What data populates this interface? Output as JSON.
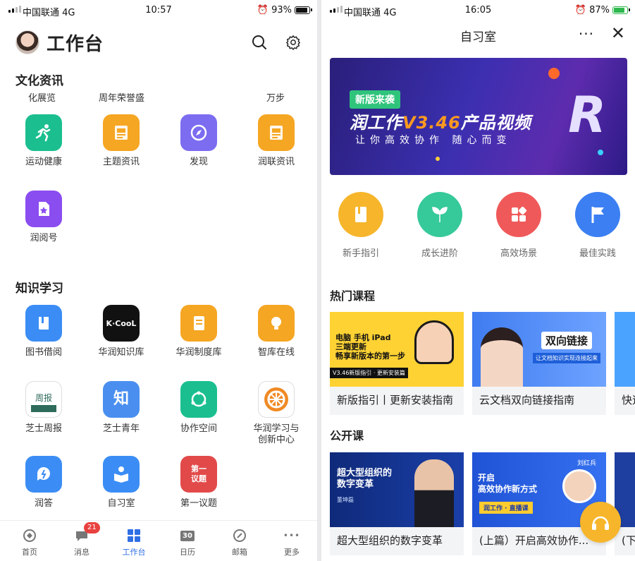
{
  "left_screen": {
    "status": {
      "carrier": "中国联通 4G",
      "time": "10:57",
      "battery": "93%",
      "battery_level": 0.93
    },
    "header": {
      "title": "工作台"
    },
    "culture": {
      "title": "文化资讯",
      "sublabels": [
        "化展览",
        "周年荣誉盛",
        "万步"
      ],
      "apps": [
        {
          "label": "运动健康",
          "icon": "running-icon",
          "color": "#1bbf8f"
        },
        {
          "label": "主题资讯",
          "icon": "news-icon",
          "color": "#f5a623"
        },
        {
          "label": "发现",
          "icon": "compass-icon",
          "color": "#7b6cf0"
        },
        {
          "label": "润联资讯",
          "icon": "news-icon",
          "color": "#f5a623"
        },
        {
          "label": "润阅号",
          "icon": "star-doc-icon",
          "color": "#8a4df0"
        }
      ]
    },
    "knowledge": {
      "title": "知识学习",
      "apps": [
        {
          "label": "图书借阅",
          "icon": "book-icon",
          "color": "#3b8df5"
        },
        {
          "label": "华润知识库",
          "icon": "kcool-logo",
          "color": "#111111",
          "logo_text": "K·CooL"
        },
        {
          "label": "华润制度库",
          "icon": "manual-icon",
          "color": "#f5a623"
        },
        {
          "label": "智库在线",
          "icon": "bulb-icon",
          "color": "#f5a623"
        },
        {
          "label": "芝士周报",
          "icon": "weekly-icon",
          "color": "#2e6b5b"
        },
        {
          "label": "芝士青年",
          "icon": "zhi-icon",
          "color": "#4a8ff0",
          "glyph": "知"
        },
        {
          "label": "协作空间",
          "icon": "collab-icon",
          "color": "#1bbf8f"
        },
        {
          "label": "华润学习与\n创新中心",
          "icon": "emblem-icon",
          "color": "#f08a24"
        },
        {
          "label": "润答",
          "icon": "qa-icon",
          "color": "#3b8df5"
        },
        {
          "label": "自习室",
          "icon": "reader-icon",
          "color": "#3b8df5"
        },
        {
          "label": "第一议题",
          "icon": "topic-icon",
          "color": "#e24a4a",
          "glyph": "第一\n议题"
        }
      ]
    },
    "tabbar": [
      {
        "label": "首页",
        "icon": "home-icon"
      },
      {
        "label": "消息",
        "icon": "message-icon",
        "badge": "21"
      },
      {
        "label": "工作台",
        "icon": "grid-icon",
        "active": true
      },
      {
        "label": "日历",
        "icon": "calendar-icon",
        "glyph": "30"
      },
      {
        "label": "邮箱",
        "icon": "mail-icon"
      },
      {
        "label": "更多",
        "icon": "more-icon",
        "glyph": "•••"
      }
    ]
  },
  "right_screen": {
    "status": {
      "carrier": "中国联通 4G",
      "time": "16:05",
      "battery": "87%",
      "battery_level": 0.87
    },
    "header": {
      "title": "自习室",
      "more": "···",
      "close": "✕"
    },
    "banner": {
      "tag": "新版来袭",
      "headline_prefix": "润工作",
      "headline_version": "V3.46",
      "headline_suffix": "产品视频",
      "subline": "让你高效协作 随心而变"
    },
    "quick": [
      {
        "label": "新手指引",
        "icon": "guide-book-icon",
        "color": "#f6b52b"
      },
      {
        "label": "成长进阶",
        "icon": "sprout-icon",
        "color": "#36c99a"
      },
      {
        "label": "高效场景",
        "icon": "apps-icon",
        "color": "#f0595a"
      },
      {
        "label": "最佳实践",
        "icon": "flag-icon",
        "color": "#3b7ff2"
      }
    ],
    "hot_courses": {
      "title": "热门课程",
      "items": [
        {
          "title": "新版指引丨更新安装指南",
          "cover_lines": [
            "电脑 手机 iPad",
            "三端更新",
            "畅享新版本的第一步"
          ],
          "cover_footer": "V3.46新版指引 · 更新安装篇"
        },
        {
          "title": "云文档双向链接指南",
          "cover_lines": [
            "双向链接"
          ],
          "cover_footer": "让文档知识实现连接起来"
        },
        {
          "title": "快速"
        }
      ]
    },
    "open_courses": {
      "title": "公开课",
      "items": [
        {
          "title": "超大型组织的数字变革",
          "cover_lines": [
            "超大型组织的",
            "数字变革"
          ],
          "speaker": "董坤磊"
        },
        {
          "title": "(上篇）开启高效协作...",
          "cover_lines": [
            "开启",
            "高效协作新方式"
          ],
          "cover_footer": "润工作 · 直播课",
          "speaker": "刘红兵"
        },
        {
          "title": "(下"
        }
      ]
    }
  }
}
